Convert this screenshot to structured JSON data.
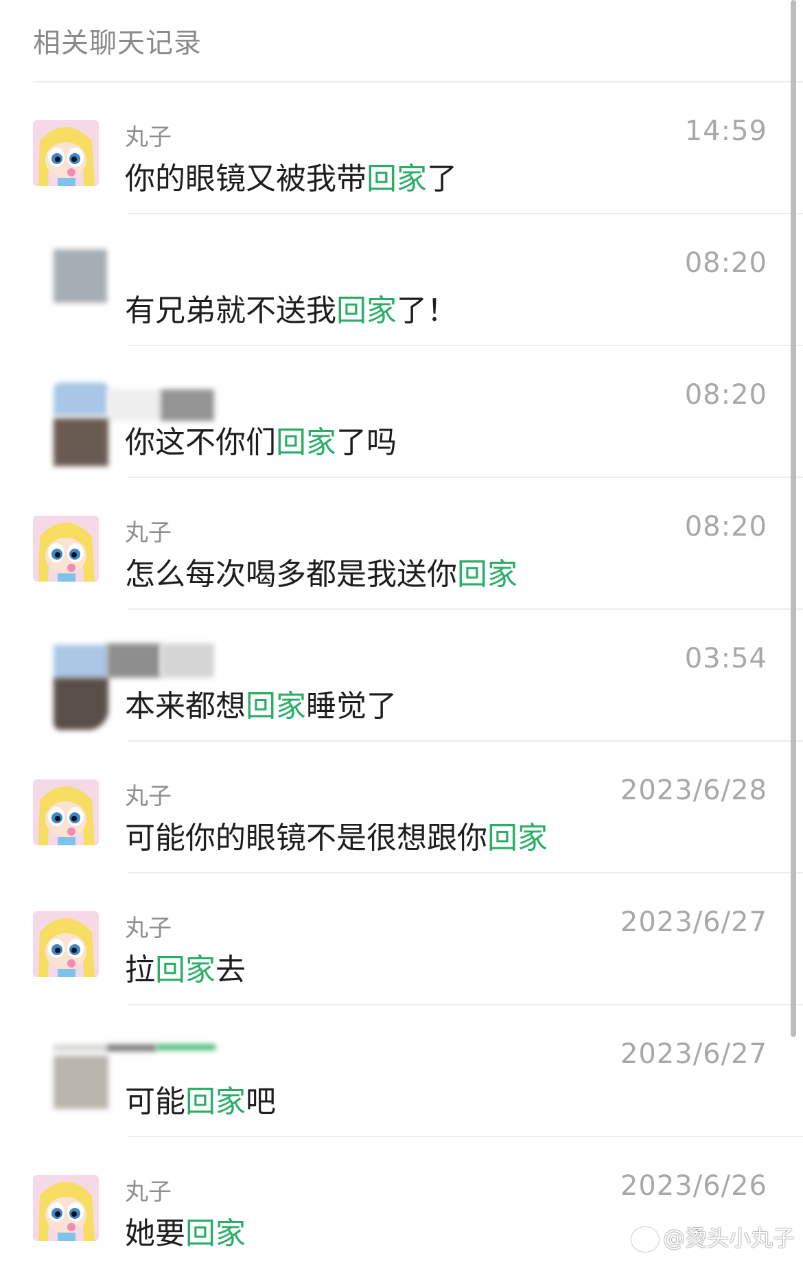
{
  "header": {
    "title": "相关聊天记录"
  },
  "keyword": "回家",
  "messages": [
    {
      "sender": "丸子",
      "time": "14:59",
      "before": "你的眼镜又被我带",
      "after": "了",
      "avatar": "cartoon"
    },
    {
      "sender": "",
      "time": "08:20",
      "before": "有兄弟就不送我",
      "after": "了！",
      "avatar": "blurred"
    },
    {
      "sender": "",
      "time": "08:20",
      "before": "你这不你们",
      "after": "了吗",
      "avatar": "blurred"
    },
    {
      "sender": "丸子",
      "time": "08:20",
      "before": "怎么每次喝多都是我送你",
      "after": "",
      "avatar": "cartoon"
    },
    {
      "sender": "",
      "time": "03:54",
      "before": "本来都想",
      "after": "睡觉了",
      "avatar": "blurred"
    },
    {
      "sender": "丸子",
      "time": "2023/6/28",
      "before": "可能你的眼镜不是很想跟你",
      "after": "",
      "avatar": "cartoon"
    },
    {
      "sender": "丸子",
      "time": "2023/6/27",
      "before": "拉",
      "after": "去",
      "avatar": "cartoon"
    },
    {
      "sender": "",
      "time": "2023/6/27",
      "before": "可能",
      "after": "吧",
      "avatar": "blurred"
    },
    {
      "sender": "丸子",
      "time": "2023/6/26",
      "before": "她要",
      "after": "",
      "avatar": "cartoon"
    }
  ],
  "watermark": "@烫头小丸子",
  "colors": {
    "highlight": "#2aae67",
    "time": "#a8a8a8",
    "sender": "#8f8f8f"
  }
}
